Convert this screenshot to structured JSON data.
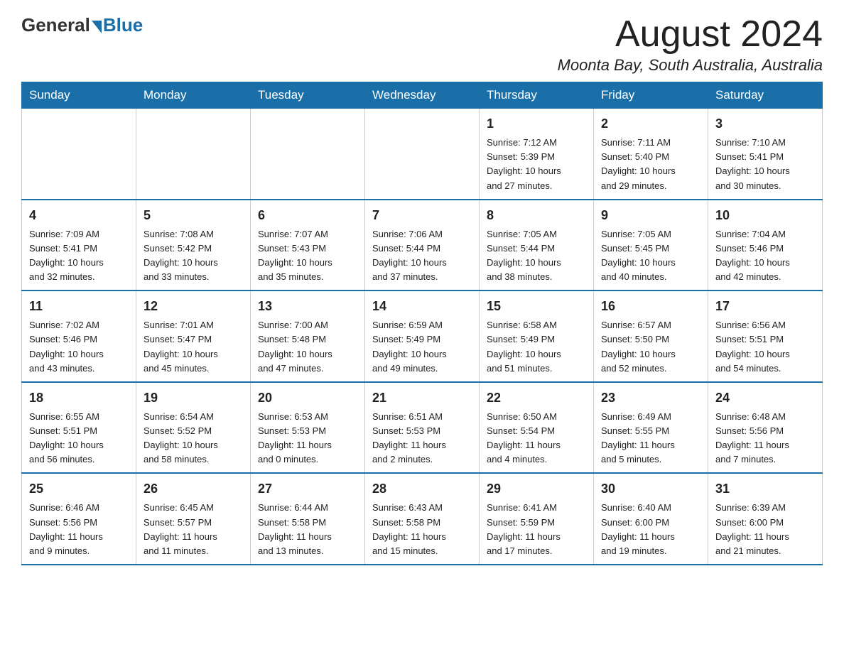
{
  "header": {
    "logo_general": "General",
    "logo_blue": "Blue",
    "month_year": "August 2024",
    "location": "Moonta Bay, South Australia, Australia"
  },
  "days_of_week": [
    "Sunday",
    "Monday",
    "Tuesday",
    "Wednesday",
    "Thursday",
    "Friday",
    "Saturday"
  ],
  "weeks": [
    [
      {
        "day": "",
        "info": ""
      },
      {
        "day": "",
        "info": ""
      },
      {
        "day": "",
        "info": ""
      },
      {
        "day": "",
        "info": ""
      },
      {
        "day": "1",
        "info": "Sunrise: 7:12 AM\nSunset: 5:39 PM\nDaylight: 10 hours\nand 27 minutes."
      },
      {
        "day": "2",
        "info": "Sunrise: 7:11 AM\nSunset: 5:40 PM\nDaylight: 10 hours\nand 29 minutes."
      },
      {
        "day": "3",
        "info": "Sunrise: 7:10 AM\nSunset: 5:41 PM\nDaylight: 10 hours\nand 30 minutes."
      }
    ],
    [
      {
        "day": "4",
        "info": "Sunrise: 7:09 AM\nSunset: 5:41 PM\nDaylight: 10 hours\nand 32 minutes."
      },
      {
        "day": "5",
        "info": "Sunrise: 7:08 AM\nSunset: 5:42 PM\nDaylight: 10 hours\nand 33 minutes."
      },
      {
        "day": "6",
        "info": "Sunrise: 7:07 AM\nSunset: 5:43 PM\nDaylight: 10 hours\nand 35 minutes."
      },
      {
        "day": "7",
        "info": "Sunrise: 7:06 AM\nSunset: 5:44 PM\nDaylight: 10 hours\nand 37 minutes."
      },
      {
        "day": "8",
        "info": "Sunrise: 7:05 AM\nSunset: 5:44 PM\nDaylight: 10 hours\nand 38 minutes."
      },
      {
        "day": "9",
        "info": "Sunrise: 7:05 AM\nSunset: 5:45 PM\nDaylight: 10 hours\nand 40 minutes."
      },
      {
        "day": "10",
        "info": "Sunrise: 7:04 AM\nSunset: 5:46 PM\nDaylight: 10 hours\nand 42 minutes."
      }
    ],
    [
      {
        "day": "11",
        "info": "Sunrise: 7:02 AM\nSunset: 5:46 PM\nDaylight: 10 hours\nand 43 minutes."
      },
      {
        "day": "12",
        "info": "Sunrise: 7:01 AM\nSunset: 5:47 PM\nDaylight: 10 hours\nand 45 minutes."
      },
      {
        "day": "13",
        "info": "Sunrise: 7:00 AM\nSunset: 5:48 PM\nDaylight: 10 hours\nand 47 minutes."
      },
      {
        "day": "14",
        "info": "Sunrise: 6:59 AM\nSunset: 5:49 PM\nDaylight: 10 hours\nand 49 minutes."
      },
      {
        "day": "15",
        "info": "Sunrise: 6:58 AM\nSunset: 5:49 PM\nDaylight: 10 hours\nand 51 minutes."
      },
      {
        "day": "16",
        "info": "Sunrise: 6:57 AM\nSunset: 5:50 PM\nDaylight: 10 hours\nand 52 minutes."
      },
      {
        "day": "17",
        "info": "Sunrise: 6:56 AM\nSunset: 5:51 PM\nDaylight: 10 hours\nand 54 minutes."
      }
    ],
    [
      {
        "day": "18",
        "info": "Sunrise: 6:55 AM\nSunset: 5:51 PM\nDaylight: 10 hours\nand 56 minutes."
      },
      {
        "day": "19",
        "info": "Sunrise: 6:54 AM\nSunset: 5:52 PM\nDaylight: 10 hours\nand 58 minutes."
      },
      {
        "day": "20",
        "info": "Sunrise: 6:53 AM\nSunset: 5:53 PM\nDaylight: 11 hours\nand 0 minutes."
      },
      {
        "day": "21",
        "info": "Sunrise: 6:51 AM\nSunset: 5:53 PM\nDaylight: 11 hours\nand 2 minutes."
      },
      {
        "day": "22",
        "info": "Sunrise: 6:50 AM\nSunset: 5:54 PM\nDaylight: 11 hours\nand 4 minutes."
      },
      {
        "day": "23",
        "info": "Sunrise: 6:49 AM\nSunset: 5:55 PM\nDaylight: 11 hours\nand 5 minutes."
      },
      {
        "day": "24",
        "info": "Sunrise: 6:48 AM\nSunset: 5:56 PM\nDaylight: 11 hours\nand 7 minutes."
      }
    ],
    [
      {
        "day": "25",
        "info": "Sunrise: 6:46 AM\nSunset: 5:56 PM\nDaylight: 11 hours\nand 9 minutes."
      },
      {
        "day": "26",
        "info": "Sunrise: 6:45 AM\nSunset: 5:57 PM\nDaylight: 11 hours\nand 11 minutes."
      },
      {
        "day": "27",
        "info": "Sunrise: 6:44 AM\nSunset: 5:58 PM\nDaylight: 11 hours\nand 13 minutes."
      },
      {
        "day": "28",
        "info": "Sunrise: 6:43 AM\nSunset: 5:58 PM\nDaylight: 11 hours\nand 15 minutes."
      },
      {
        "day": "29",
        "info": "Sunrise: 6:41 AM\nSunset: 5:59 PM\nDaylight: 11 hours\nand 17 minutes."
      },
      {
        "day": "30",
        "info": "Sunrise: 6:40 AM\nSunset: 6:00 PM\nDaylight: 11 hours\nand 19 minutes."
      },
      {
        "day": "31",
        "info": "Sunrise: 6:39 AM\nSunset: 6:00 PM\nDaylight: 11 hours\nand 21 minutes."
      }
    ]
  ]
}
